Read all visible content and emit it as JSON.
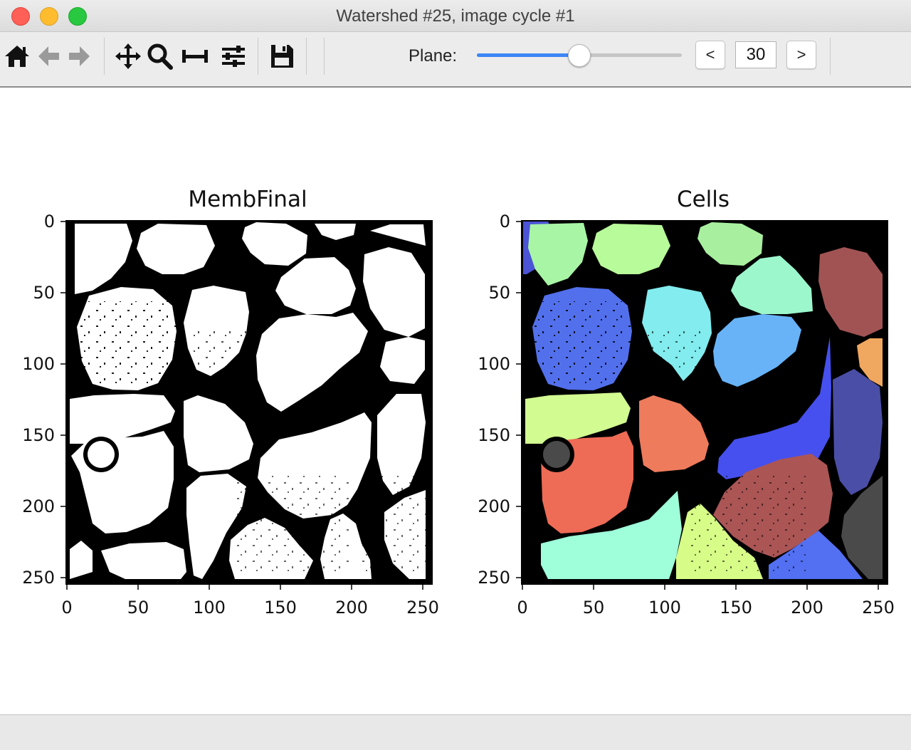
{
  "window": {
    "title": "Watershed #25, image cycle #1"
  },
  "toolbar": {
    "icons": [
      "home-icon",
      "back-arrow-icon",
      "forward-arrow-icon",
      "pan-icon",
      "zoom-icon",
      "subplots-icon",
      "configure-icon",
      "save-icon"
    ],
    "plane_label": "Plane:",
    "prev_label": "<",
    "next_label": ">",
    "plane_value": "30",
    "slider_fraction": 0.5,
    "accent_color": "#3d86f5"
  },
  "figure": {
    "panels": [
      {
        "title": "MembFinal",
        "type": "binary-image",
        "xticks": [
          "0",
          "50",
          "100",
          "150",
          "200",
          "250"
        ],
        "yticks": [
          "0",
          "50",
          "100",
          "150",
          "200",
          "250"
        ]
      },
      {
        "title": "Cells",
        "type": "label-image",
        "xticks": [
          "0",
          "50",
          "100",
          "150",
          "200",
          "250"
        ],
        "yticks": [
          "0",
          "50",
          "100",
          "150",
          "200",
          "250"
        ],
        "label_colors": [
          "#4b54d6",
          "#a8f5a6",
          "#b8fb9a",
          "#a8f0a0",
          "#a15354",
          "#9cf7cd",
          "#5270ec",
          "#82ecee",
          "#68b3f7",
          "#f0a760",
          "#d2fb91",
          "#ee7b5c",
          "#4650ef",
          "#4b4ea6",
          "#ee6b55",
          "#9effda",
          "#d8fc88",
          "#ab5555",
          "#536ff2",
          "#4a4a4a"
        ]
      }
    ]
  }
}
